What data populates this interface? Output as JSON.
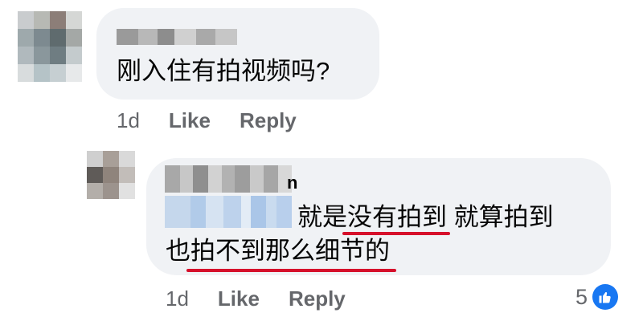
{
  "comments": [
    {
      "text": "刚入住有拍视频吗?",
      "timestamp": "1d",
      "like_label": "Like",
      "reply_label": "Reply"
    }
  ],
  "reply": {
    "author_visible_suffix": "n",
    "line1": {
      "seg1": "就是",
      "seg2": "没有拍到",
      "seg3": " 就算拍到"
    },
    "line2": {
      "seg1": "也",
      "seg2": "拍不到那么细节的"
    },
    "timestamp": "1d",
    "like_label": "Like",
    "reply_label": "Reply",
    "reaction_count": "5",
    "reaction_icon": "thumbs-up-icon"
  },
  "colors": {
    "bubble": "#f0f2f5",
    "meta_text": "#65676b",
    "underline": "#d6102b",
    "like_blue": "#1877f2"
  }
}
